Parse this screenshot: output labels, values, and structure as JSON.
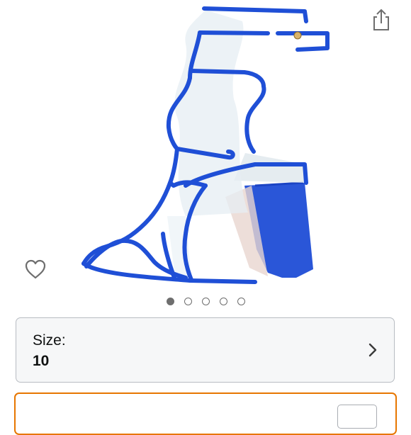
{
  "colors": {
    "accent_orange": "#e77600",
    "shoe_blue": "#1f4fd6",
    "icon_gray": "#6e6e6e"
  },
  "icons": {
    "share": "share-icon",
    "favorite": "heart-icon",
    "chevron": "chevron-right-icon"
  },
  "gallery": {
    "image_count": 5,
    "active_index": 0
  },
  "size_selector": {
    "label": "Size:",
    "value": "10"
  },
  "quantity_selector": {
    "label": "",
    "value": ""
  }
}
